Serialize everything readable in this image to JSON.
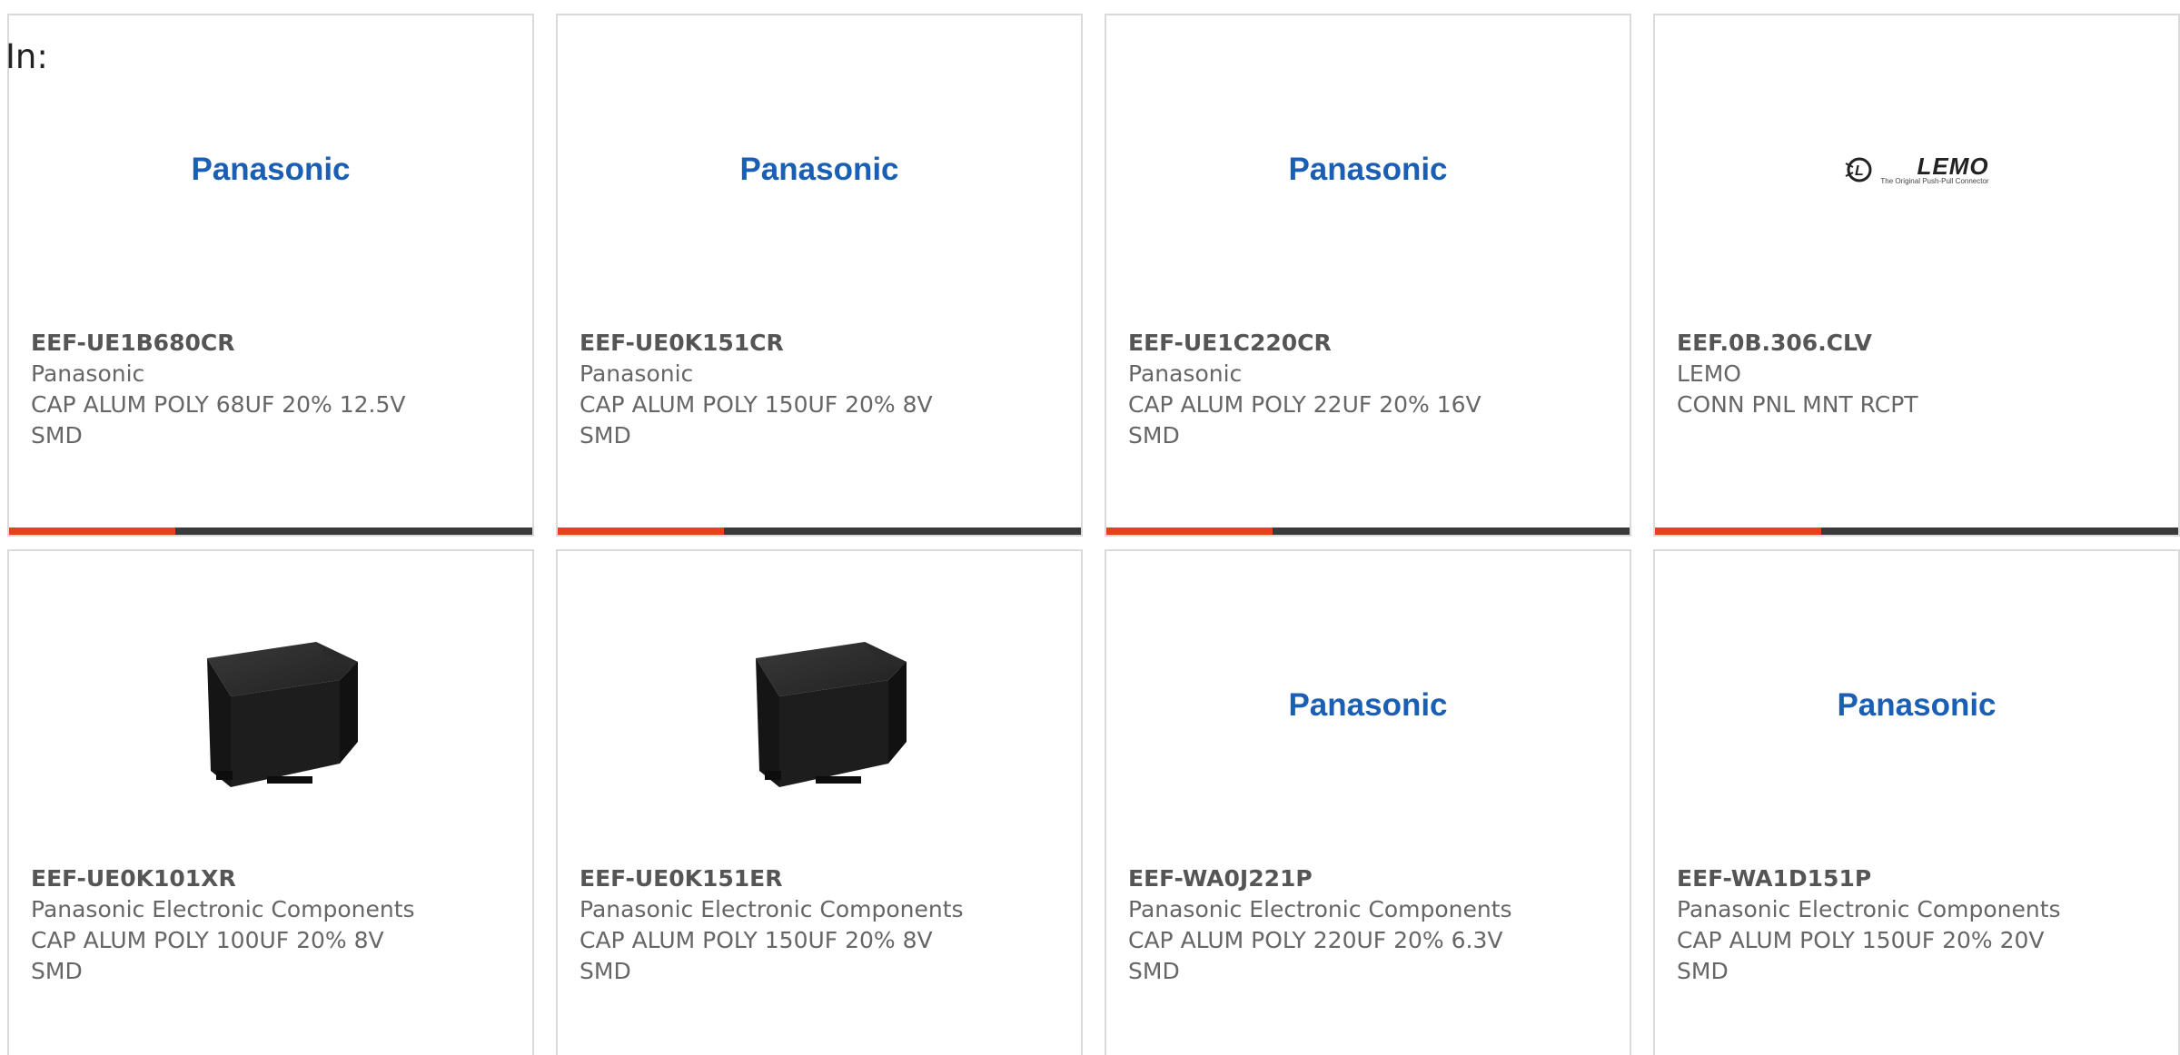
{
  "header": {
    "in_label": "In:"
  },
  "colors": {
    "accent_bar": "#e8411a",
    "bar_dark": "#3a3a3a",
    "panasonic_blue": "#1a5fb4"
  },
  "products": [
    {
      "part_number": "EEF-UE1B680CR",
      "manufacturer": "Panasonic",
      "desc_line1": "CAP ALUM POLY 68UF 20% 12.5V",
      "desc_line2": "SMD",
      "image": "panasonic-logo",
      "logo_text": "Panasonic"
    },
    {
      "part_number": "EEF-UE0K151CR",
      "manufacturer": "Panasonic",
      "desc_line1": "CAP ALUM POLY 150UF 20% 8V",
      "desc_line2": "SMD",
      "image": "panasonic-logo",
      "logo_text": "Panasonic"
    },
    {
      "part_number": "EEF-UE1C220CR",
      "manufacturer": "Panasonic",
      "desc_line1": "CAP ALUM POLY 22UF 20% 16V",
      "desc_line2": "SMD",
      "image": "panasonic-logo",
      "logo_text": "Panasonic"
    },
    {
      "part_number": "EEF.0B.306.CLV",
      "manufacturer": "LEMO",
      "desc_line1": "CONN PNL MNT RCPT",
      "desc_line2": "",
      "image": "lemo-logo",
      "logo_text": "LEMO",
      "logo_tagline": "The Original Push-Pull Connector"
    },
    {
      "part_number": "EEF-UE0K101XR",
      "manufacturer": "Panasonic Electronic Components",
      "desc_line1": "CAP ALUM POLY 100UF 20% 8V",
      "desc_line2": "SMD",
      "image": "capacitor-photo"
    },
    {
      "part_number": "EEF-UE0K151ER",
      "manufacturer": "Panasonic Electronic Components",
      "desc_line1": "CAP ALUM POLY 150UF 20% 8V",
      "desc_line2": "SMD",
      "image": "capacitor-photo"
    },
    {
      "part_number": "EEF-WA0J221P",
      "manufacturer": "Panasonic Electronic Components",
      "desc_line1": "CAP ALUM POLY 220UF 20% 6.3V",
      "desc_line2": "SMD",
      "image": "panasonic-logo",
      "logo_text": "Panasonic"
    },
    {
      "part_number": "EEF-WA1D151P",
      "manufacturer": "Panasonic Electronic Components",
      "desc_line1": "CAP ALUM POLY 150UF 20% 20V",
      "desc_line2": "SMD",
      "image": "panasonic-logo",
      "logo_text": "Panasonic"
    }
  ]
}
